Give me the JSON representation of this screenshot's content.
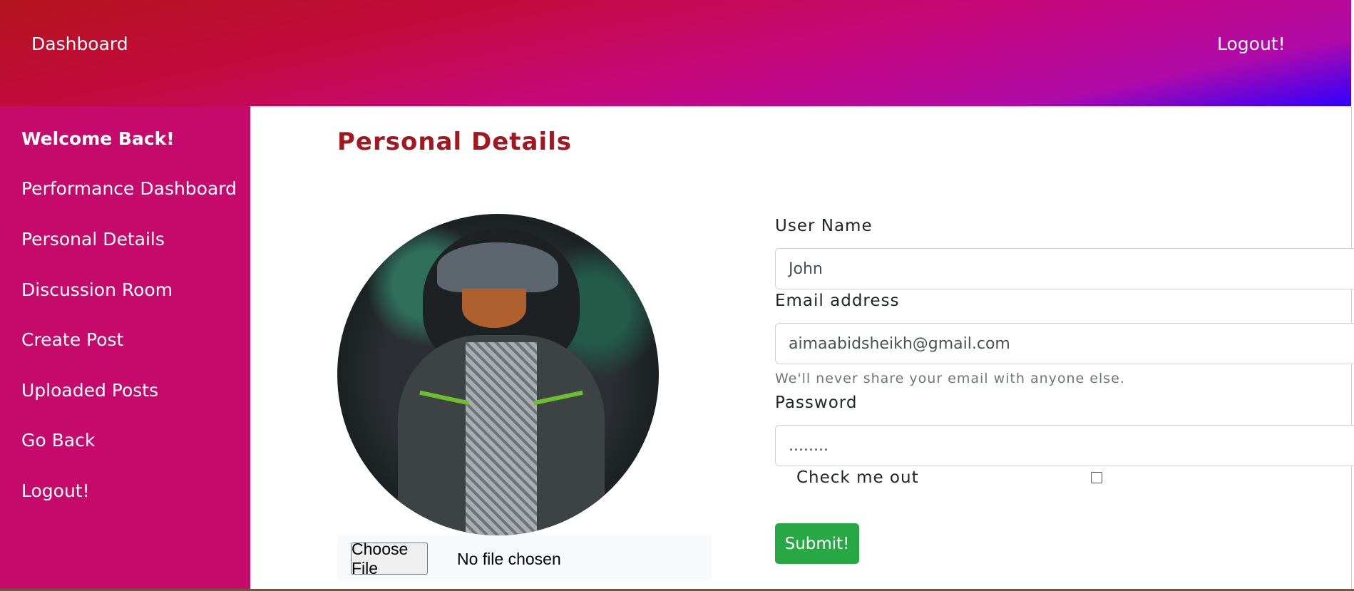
{
  "header": {
    "brand": "Dashboard",
    "logout": "Logout!"
  },
  "sidebar": {
    "items": [
      {
        "label": "Welcome Back!"
      },
      {
        "label": "Performance Dashboard"
      },
      {
        "label": "Personal Details"
      },
      {
        "label": "Discussion Room"
      },
      {
        "label": "Create Post"
      },
      {
        "label": "Uploaded Posts"
      },
      {
        "label": "Go Back"
      },
      {
        "label": "Logout!"
      }
    ]
  },
  "main": {
    "title": "Personal Details",
    "file_input": {
      "button_label": "Choose File",
      "status": "No file chosen"
    },
    "form": {
      "username_label": "User Name",
      "username_value": "John",
      "email_label": "Email address",
      "email_value": "aimaabidsheikh@gmail.com",
      "email_help": "We'll never share your email with anyone else.",
      "password_label": "Password",
      "password_value": "........",
      "check_label": "Check me out",
      "submit_label": "Submit!"
    }
  },
  "colors": {
    "sidebar_bg": "#c60a6b",
    "title_color": "#a3171e",
    "submit_bg": "#28a745"
  }
}
